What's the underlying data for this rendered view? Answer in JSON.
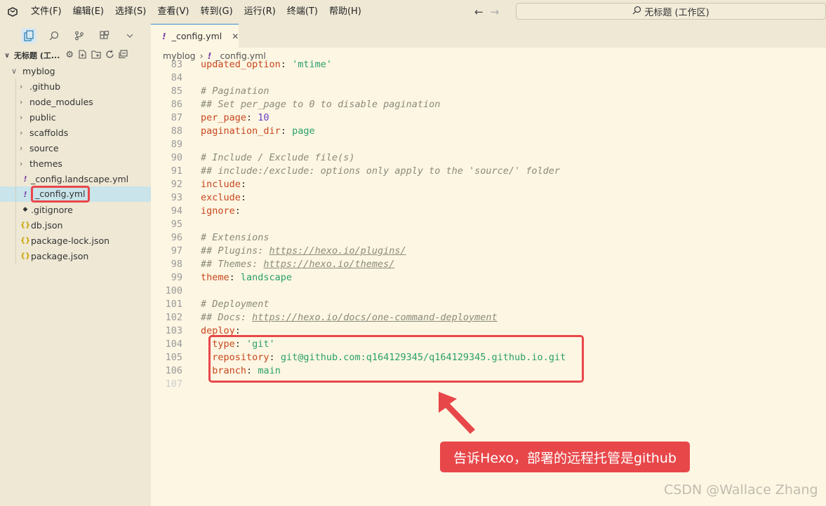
{
  "menu": [
    "文件(F)",
    "编辑(E)",
    "选择(S)",
    "查看(V)",
    "转到(G)",
    "运行(R)",
    "终端(T)",
    "帮助(H)"
  ],
  "search": {
    "label": "无标题 (工作区)"
  },
  "workspace": {
    "label": "无标题 (工..."
  },
  "tree": {
    "root": "myblog",
    "items": [
      {
        "label": ".github",
        "type": "folder"
      },
      {
        "label": "node_modules",
        "type": "folder"
      },
      {
        "label": "public",
        "type": "folder"
      },
      {
        "label": "scaffolds",
        "type": "folder"
      },
      {
        "label": "source",
        "type": "folder"
      },
      {
        "label": "themes",
        "type": "folder"
      },
      {
        "label": "_config.landscape.yml",
        "type": "yml"
      },
      {
        "label": "_config.yml",
        "type": "yml",
        "selected": true
      },
      {
        "label": ".gitignore",
        "type": "git"
      },
      {
        "label": "db.json",
        "type": "json"
      },
      {
        "label": "package-lock.json",
        "type": "json"
      },
      {
        "label": "package.json",
        "type": "json"
      }
    ]
  },
  "tab": {
    "label": "_config.yml",
    "icon": "!"
  },
  "breadcrumb": {
    "folder": "myblog",
    "file": "_config.yml"
  },
  "code": [
    {
      "n": "83",
      "parts": [
        [
          "key",
          "updated_option"
        ],
        [
          "p",
          ": "
        ],
        [
          "val-str",
          "'mtime'"
        ]
      ]
    },
    {
      "n": "84",
      "parts": []
    },
    {
      "n": "85",
      "parts": [
        [
          "cmt",
          "# Pagination"
        ]
      ]
    },
    {
      "n": "86",
      "parts": [
        [
          "cmt",
          "## Set per_page to 0 to disable pagination"
        ]
      ]
    },
    {
      "n": "87",
      "parts": [
        [
          "key",
          "per_page"
        ],
        [
          "p",
          ": "
        ],
        [
          "val-num",
          "10"
        ]
      ]
    },
    {
      "n": "88",
      "parts": [
        [
          "key",
          "pagination_dir"
        ],
        [
          "p",
          ": "
        ],
        [
          "val-str",
          "page"
        ]
      ]
    },
    {
      "n": "89",
      "parts": []
    },
    {
      "n": "90",
      "parts": [
        [
          "cmt",
          "# Include / Exclude file(s)"
        ]
      ]
    },
    {
      "n": "91",
      "parts": [
        [
          "cmt",
          "## include:/exclude: options only apply to the 'source/' folder"
        ]
      ]
    },
    {
      "n": "92",
      "parts": [
        [
          "key",
          "include"
        ],
        [
          "p",
          ":"
        ]
      ]
    },
    {
      "n": "93",
      "parts": [
        [
          "key",
          "exclude"
        ],
        [
          "p",
          ":"
        ]
      ]
    },
    {
      "n": "94",
      "parts": [
        [
          "key",
          "ignore"
        ],
        [
          "p",
          ":"
        ]
      ]
    },
    {
      "n": "95",
      "parts": []
    },
    {
      "n": "96",
      "parts": [
        [
          "cmt",
          "# Extensions"
        ]
      ]
    },
    {
      "n": "97",
      "parts": [
        [
          "cmt",
          "## Plugins: "
        ],
        [
          "cmt link",
          "https://hexo.io/plugins/"
        ]
      ]
    },
    {
      "n": "98",
      "parts": [
        [
          "cmt",
          "## Themes: "
        ],
        [
          "cmt link",
          "https://hexo.io/themes/"
        ]
      ]
    },
    {
      "n": "99",
      "parts": [
        [
          "key",
          "theme"
        ],
        [
          "p",
          ": "
        ],
        [
          "val-str",
          "landscape"
        ]
      ]
    },
    {
      "n": "100",
      "parts": []
    },
    {
      "n": "101",
      "parts": [
        [
          "cmt",
          "# Deployment"
        ]
      ]
    },
    {
      "n": "102",
      "parts": [
        [
          "cmt",
          "## Docs: "
        ],
        [
          "cmt link",
          "https://hexo.io/docs/one-command-deployment"
        ]
      ]
    },
    {
      "n": "103",
      "parts": [
        [
          "key",
          "deploy"
        ],
        [
          "p",
          ":"
        ]
      ]
    },
    {
      "n": "104",
      "parts": [
        [
          "p",
          "  "
        ],
        [
          "key",
          "type"
        ],
        [
          "p",
          ": "
        ],
        [
          "val-str",
          "'git'"
        ]
      ]
    },
    {
      "n": "105",
      "parts": [
        [
          "p",
          "  "
        ],
        [
          "key",
          "repository"
        ],
        [
          "p",
          ": "
        ],
        [
          "val-str",
          "git@github.com:q164129345/q164129345.github.io.git"
        ]
      ]
    },
    {
      "n": "106",
      "parts": [
        [
          "p",
          "  "
        ],
        [
          "key",
          "branch"
        ],
        [
          "p",
          ": "
        ],
        [
          "val-str",
          "main"
        ]
      ]
    },
    {
      "n": "107",
      "parts": []
    }
  ],
  "annotation": {
    "callout": "告诉Hexo，部署的远程托管是github"
  },
  "watermark": "CSDN @Wallace Zhang",
  "colors": {
    "highlight": "#e8474a",
    "background": "#fdf6e3",
    "sidebar": "#eee8d5"
  }
}
